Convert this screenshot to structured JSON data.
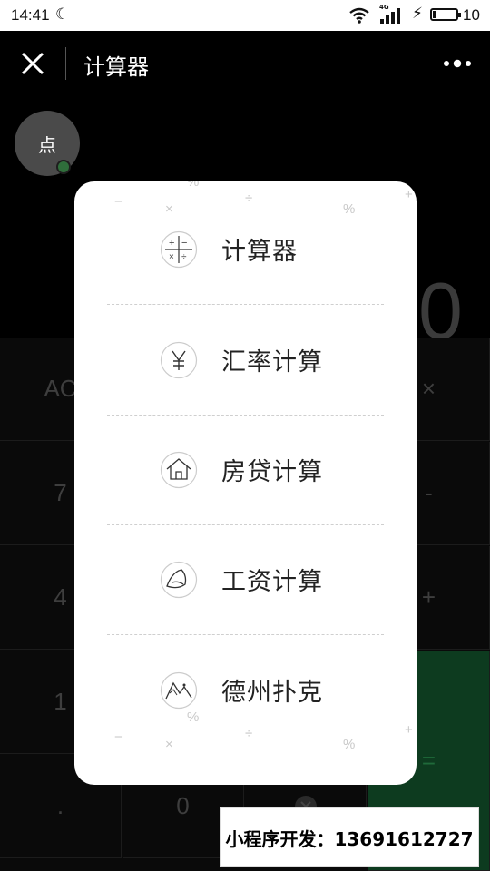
{
  "status_bar": {
    "time": "14:41",
    "network": "4G",
    "battery": "10"
  },
  "titlebar": {
    "title": "计算器"
  },
  "float_button": {
    "label": "点"
  },
  "display": {
    "value": "0"
  },
  "keypad": {
    "keys": [
      "AC",
      "×",
      "7",
      "-",
      "4",
      "+",
      "1",
      "=",
      ".",
      "0"
    ]
  },
  "menu": {
    "items": [
      {
        "label": "计算器",
        "icon": "calculator-icon"
      },
      {
        "label": "汇率计算",
        "icon": "yen-icon"
      },
      {
        "label": "房贷计算",
        "icon": "house-icon"
      },
      {
        "label": "工资计算",
        "icon": "wallet-icon"
      },
      {
        "label": "德州扑克",
        "icon": "cards-icon"
      }
    ],
    "decor_symbols": [
      "−",
      "×",
      "%",
      "÷",
      "%",
      "+"
    ]
  },
  "promo": {
    "text": "小程序开发：13691612727"
  },
  "colors": {
    "background": "#000000",
    "modal": "#ffffff",
    "equals_key": "#0d3b1f",
    "float_dot": "#2f6e3b"
  }
}
